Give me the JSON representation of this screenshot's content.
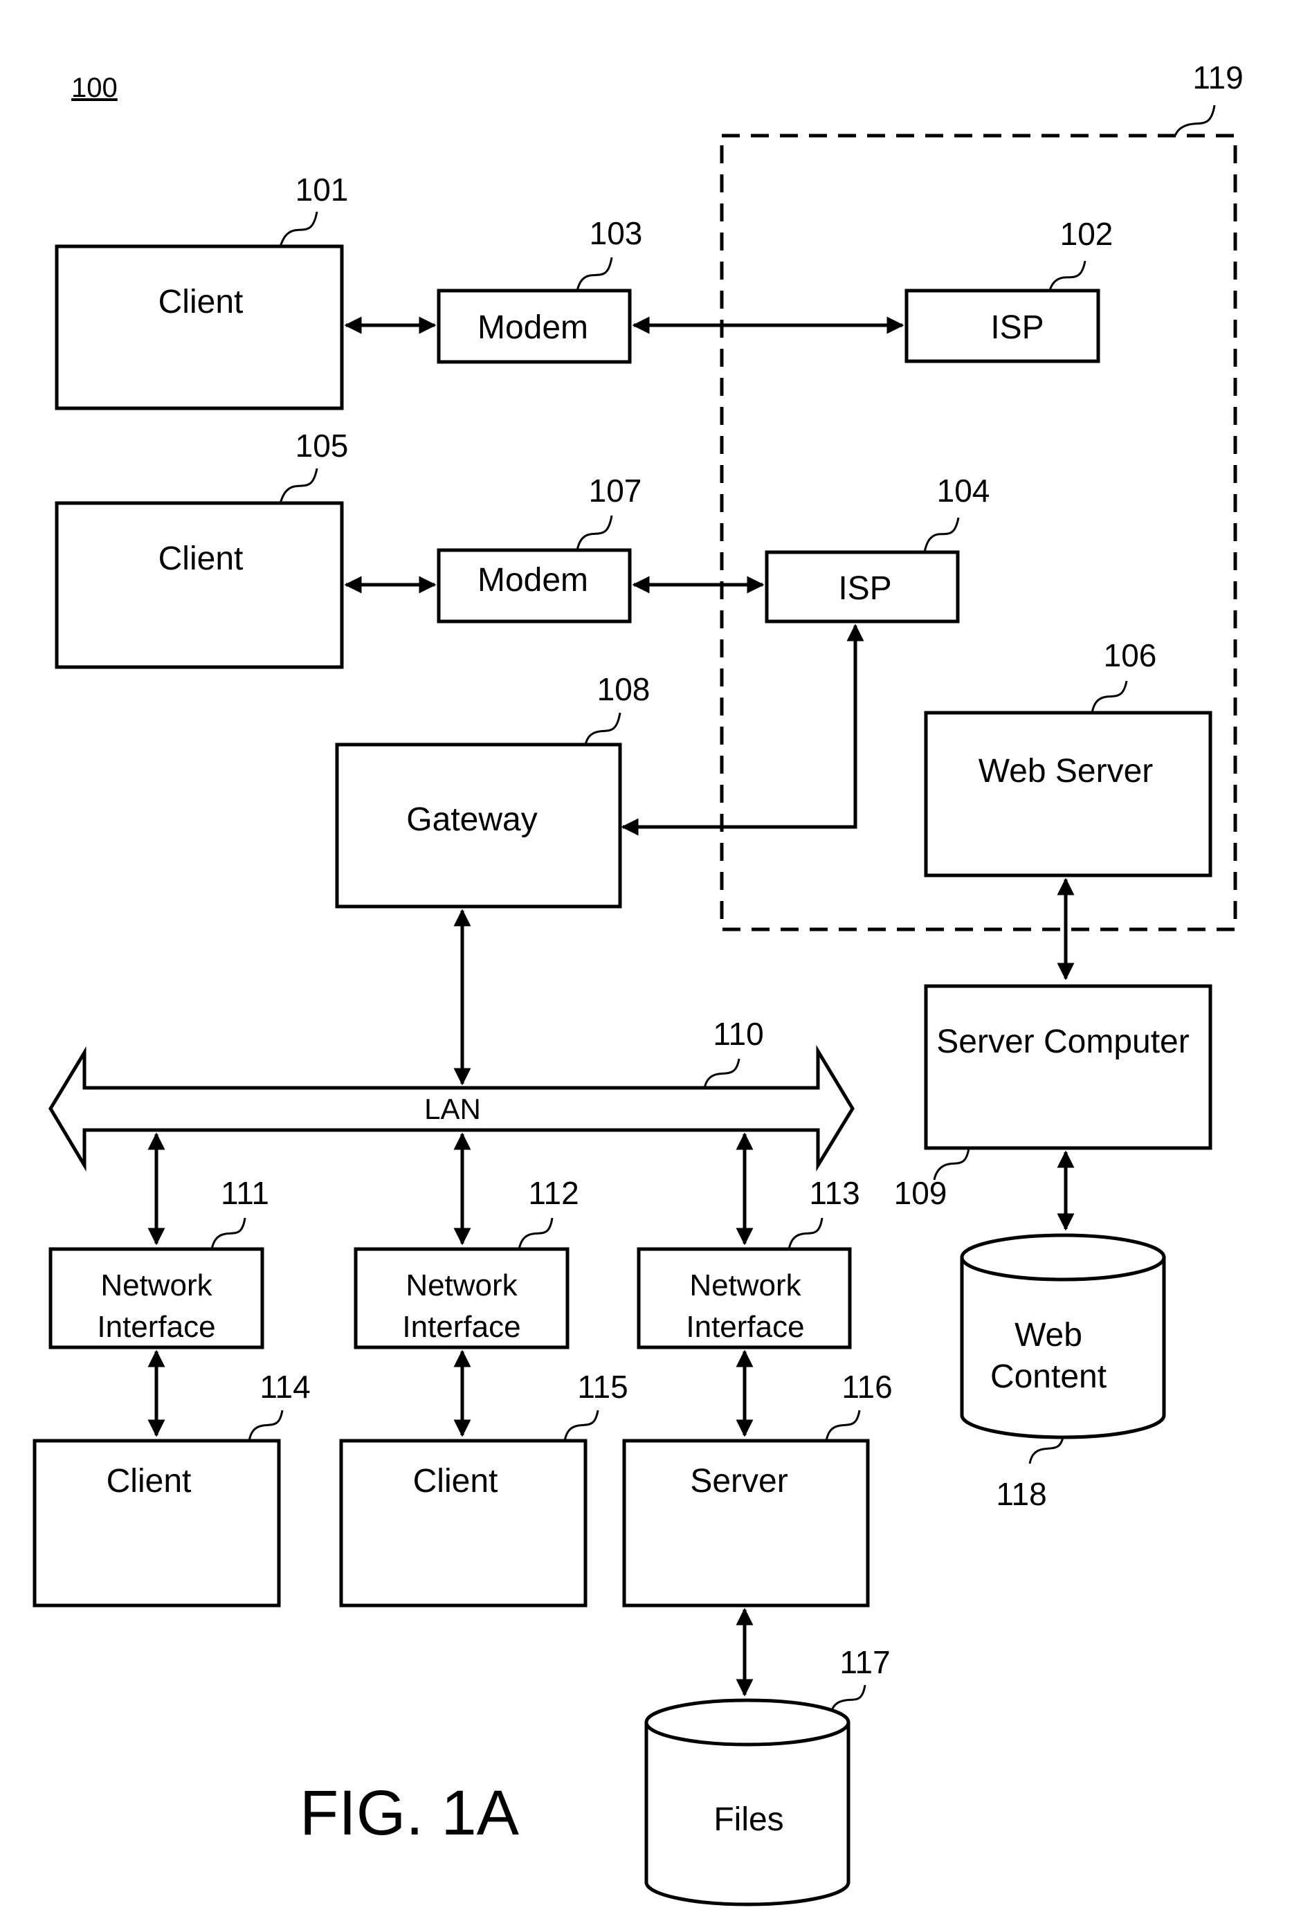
{
  "figure": {
    "reference": "100",
    "caption": "FIG. 1A"
  },
  "components": {
    "client_101": {
      "label": "Client",
      "ref": "101"
    },
    "isp_102": {
      "label": "ISP",
      "ref": "102"
    },
    "modem_103": {
      "label": "Modem",
      "ref": "103"
    },
    "isp_104": {
      "label": "ISP",
      "ref": "104"
    },
    "client_105": {
      "label": "Client",
      "ref": "105"
    },
    "web_server_106": {
      "label": "Web Server",
      "ref": "106"
    },
    "modem_107": {
      "label": "Modem",
      "ref": "107"
    },
    "gateway_108": {
      "label": "Gateway",
      "ref": "108"
    },
    "server_computer_109": {
      "label": "Server Computer",
      "ref": "109"
    },
    "lan_110": {
      "label": "LAN",
      "ref": "110"
    },
    "network_interface_111": {
      "label_line1": "Network",
      "label_line2": "Interface",
      "ref": "111"
    },
    "network_interface_112": {
      "label_line1": "Network",
      "label_line2": "Interface",
      "ref": "112"
    },
    "network_interface_113": {
      "label_line1": "Network",
      "label_line2": "Interface",
      "ref": "113"
    },
    "client_114": {
      "label": "Client",
      "ref": "114"
    },
    "client_115": {
      "label": "Client",
      "ref": "115"
    },
    "server_116": {
      "label": "Server",
      "ref": "116"
    },
    "files_117": {
      "label": "Files",
      "ref": "117"
    },
    "web_content_118": {
      "label_line1": "Web",
      "label_line2": "Content",
      "ref": "118"
    },
    "isp_group_119": {
      "ref": "119"
    }
  },
  "connections": [
    {
      "from": "client_101",
      "to": "modem_103",
      "type": "bidirectional"
    },
    {
      "from": "modem_103",
      "to": "isp_102",
      "type": "bidirectional"
    },
    {
      "from": "client_105",
      "to": "modem_107",
      "type": "bidirectional"
    },
    {
      "from": "modem_107",
      "to": "isp_104",
      "type": "bidirectional"
    },
    {
      "from": "isp_104",
      "to": "gateway_108",
      "type": "bidirectional"
    },
    {
      "from": "gateway_108",
      "to": "lan_110",
      "type": "bidirectional"
    },
    {
      "from": "lan_110",
      "to": "network_interface_111",
      "type": "bidirectional"
    },
    {
      "from": "lan_110",
      "to": "network_interface_112",
      "type": "bidirectional"
    },
    {
      "from": "lan_110",
      "to": "network_interface_113",
      "type": "bidirectional"
    },
    {
      "from": "network_interface_111",
      "to": "client_114",
      "type": "bidirectional"
    },
    {
      "from": "network_interface_112",
      "to": "client_115",
      "type": "bidirectional"
    },
    {
      "from": "network_interface_113",
      "to": "server_116",
      "type": "bidirectional"
    },
    {
      "from": "server_116",
      "to": "files_117",
      "type": "bidirectional"
    },
    {
      "from": "web_server_106",
      "to": "server_computer_109",
      "type": "bidirectional"
    },
    {
      "from": "server_computer_109",
      "to": "web_content_118",
      "type": "bidirectional"
    }
  ]
}
